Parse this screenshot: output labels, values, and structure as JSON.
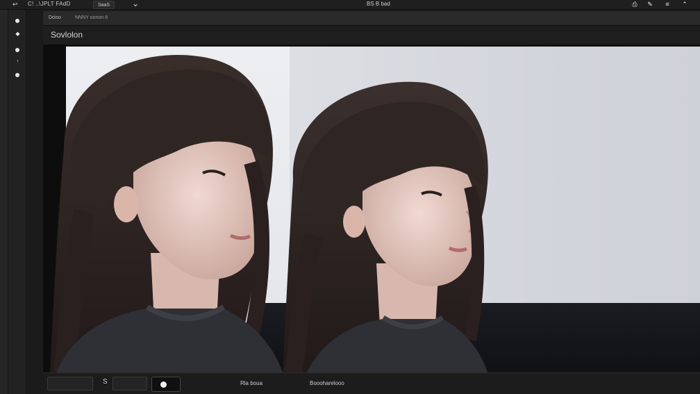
{
  "titlebar": {
    "nav_icon": "back-forward-icon",
    "app_title": "C! ..\\JPLT FAdD",
    "tab_label": "SaaS",
    "chevron_icon": "chevron-down-icon",
    "center_title": "BS  B bad",
    "right_icons": [
      "save-icon",
      "pen-icon",
      "settings-icon",
      "cursor-icon"
    ]
  },
  "subbar": {
    "crumb": "Doiso",
    "crumb2": "NNNY oonon  8"
  },
  "heading": {
    "title": "Sovlolon"
  },
  "lefttools": [
    "dot-icon",
    "diamond-icon",
    "dot-icon",
    "hand-icon",
    "dot-icon"
  ],
  "bottombar": {
    "button1": "",
    "icon_label": "S",
    "label_center": "Rla boua",
    "label_right": "Boooharelooo"
  },
  "colors": {
    "background": "#1b1b1b",
    "panel": "#2a2a2a",
    "canvas_bg_left": "#eceef1",
    "canvas_bg_right": "#d3d5dc",
    "hair": "#2e2523",
    "skin": "#e9cfc7",
    "sweater": "#2f3035"
  }
}
